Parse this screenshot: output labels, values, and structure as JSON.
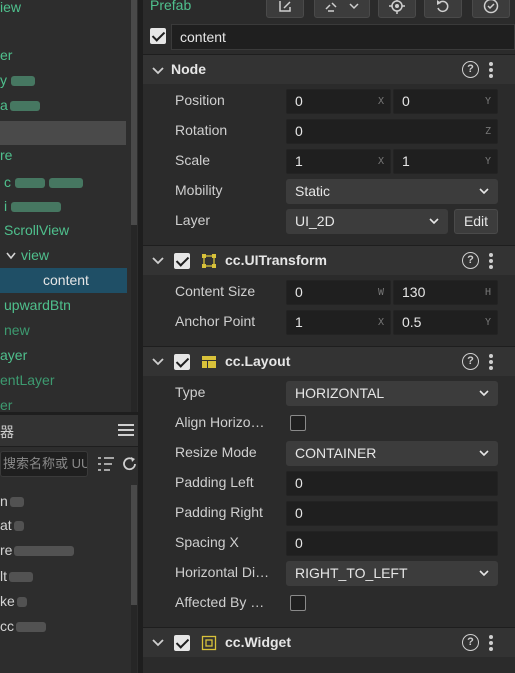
{
  "hierarchy": {
    "rows": [
      {
        "label": "iew"
      },
      {
        "label": "er"
      },
      {
        "label": "y"
      },
      {
        "label": "a"
      },
      {
        "label": ""
      },
      {
        "label": "re"
      },
      {
        "label": "c"
      },
      {
        "label": "i"
      },
      {
        "label": "ScrollView"
      },
      {
        "label": "view"
      },
      {
        "label": "content"
      },
      {
        "label": "upwardBtn"
      },
      {
        "label": "new"
      },
      {
        "label": "ayer"
      },
      {
        "label": "entLayer"
      },
      {
        "label": "er"
      }
    ]
  },
  "assets": {
    "title": "器",
    "search_placeholder": "搜索名称或 UU",
    "rows": [
      {
        "label": "n"
      },
      {
        "label": "at"
      },
      {
        "label": "re"
      },
      {
        "label": "lt"
      },
      {
        "label": "ke"
      },
      {
        "label": "cc"
      }
    ]
  },
  "inspector": {
    "prefab_label": "Prefab",
    "node_name": "content",
    "node_section": {
      "title": "Node",
      "position_label": "Position",
      "position_x": "0",
      "position_y": "0",
      "rotation_label": "Rotation",
      "rotation_z": "0",
      "scale_label": "Scale",
      "scale_x": "1",
      "scale_y": "1",
      "mobility_label": "Mobility",
      "mobility_value": "Static",
      "layer_label": "Layer",
      "layer_value": "UI_2D",
      "edit_label": "Edit"
    },
    "uitransform": {
      "title": "cc.UITransform",
      "content_size_label": "Content Size",
      "width": "0",
      "height": "130",
      "anchor_label": "Anchor Point",
      "anchor_x": "1",
      "anchor_y": "0.5"
    },
    "layout": {
      "title": "cc.Layout",
      "type_label": "Type",
      "type_value": "HORIZONTAL",
      "align_label": "Align Horizo…",
      "resize_label": "Resize Mode",
      "resize_value": "CONTAINER",
      "padding_left_label": "Padding Left",
      "padding_left": "0",
      "padding_right_label": "Padding Right",
      "padding_right": "0",
      "spacing_label": "Spacing X",
      "spacing": "0",
      "hdir_label": "Horizontal Di…",
      "hdir_value": "RIGHT_TO_LEFT",
      "affected_label": "Affected By …"
    },
    "widget": {
      "title": "cc.Widget"
    },
    "units": {
      "x": "X",
      "y": "Y",
      "z": "Z",
      "w": "W",
      "h": "H"
    },
    "help_glyph": "?"
  },
  "colors": {
    "accent_green": "#4fc08d",
    "selection": "#1f4f66",
    "background": "#2b2b2b"
  }
}
